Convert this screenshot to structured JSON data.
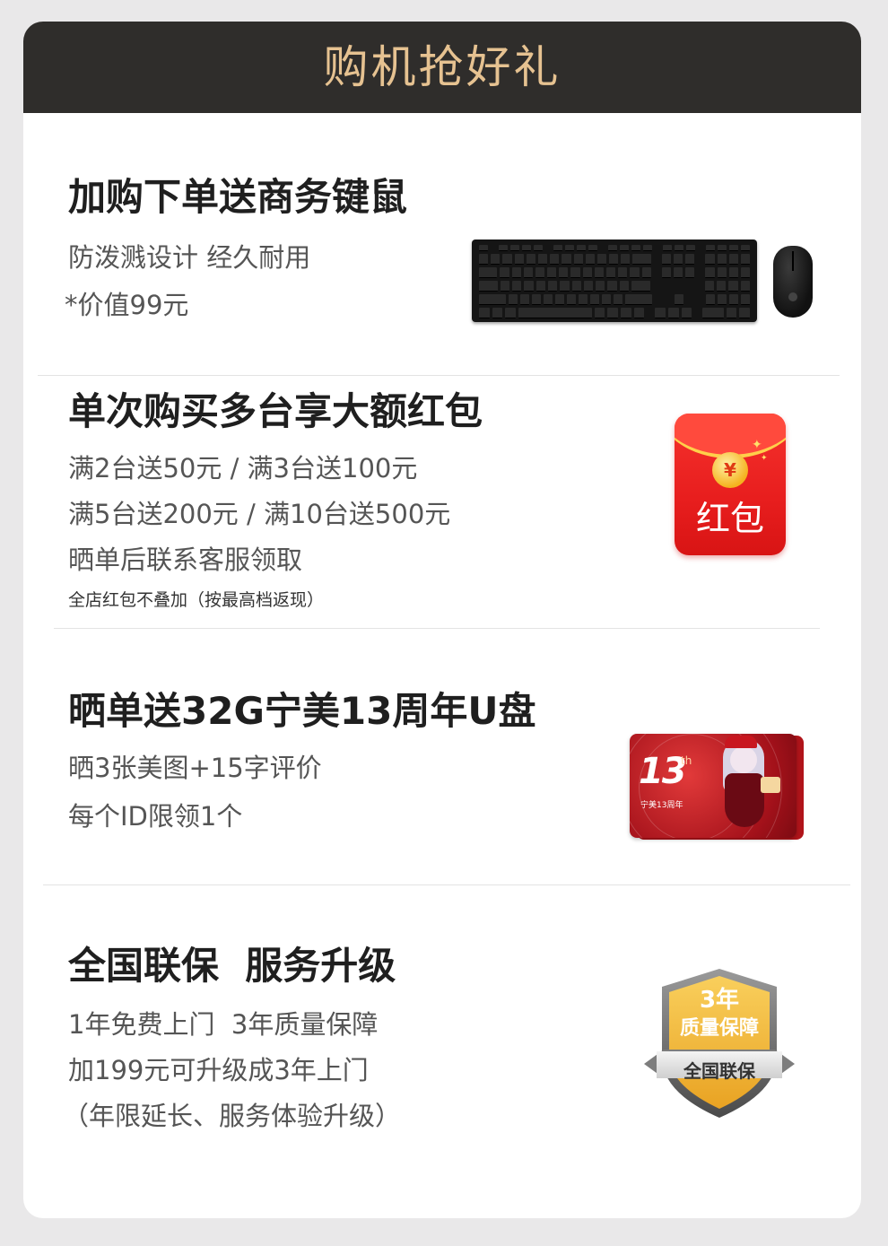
{
  "header": {
    "title": "购机抢好礼"
  },
  "sections": [
    {
      "title": "加购下单送商务键鼠",
      "lines": [
        "防泼溅设计 经久耐用",
        "*价值99元"
      ],
      "image": "keyboard-mouse-set"
    },
    {
      "title": "单次购买多台享大额红包",
      "lines": [
        "满2台送50元 / 满3台送100元",
        "满5台送200元 / 满10台送500元",
        "晒单后联系客服领取"
      ],
      "note": "全店红包不叠加（按最高档返现）",
      "image": "red-envelope",
      "image_text": "红包",
      "image_symbol": "¥"
    },
    {
      "title": "晒单送32G宁美13周年U盘",
      "lines": [
        "晒3张美图+15字评价",
        "每个ID限领1个"
      ],
      "image": "usb-card-13th",
      "image_text_main": "13",
      "image_text_sup": "th",
      "image_text_label": "宁美13周年"
    },
    {
      "title": "全国联保  服务升级",
      "lines": [
        "1年免费上门  3年质量保障",
        "加199元可升级成3年上门",
        "（年限延长、服务体验升级）"
      ],
      "image": "warranty-shield-badge",
      "badge_year": "3年",
      "badge_quality": "质量保障",
      "badge_national": "全国联保"
    }
  ],
  "colors": {
    "header_bg": "#2f2d2b",
    "header_text": "#e6c291",
    "page_bg": "#e9e8e9",
    "card_bg": "#ffffff",
    "red_packet": "#e81e1e",
    "badge_gold": "#f0b43a"
  }
}
